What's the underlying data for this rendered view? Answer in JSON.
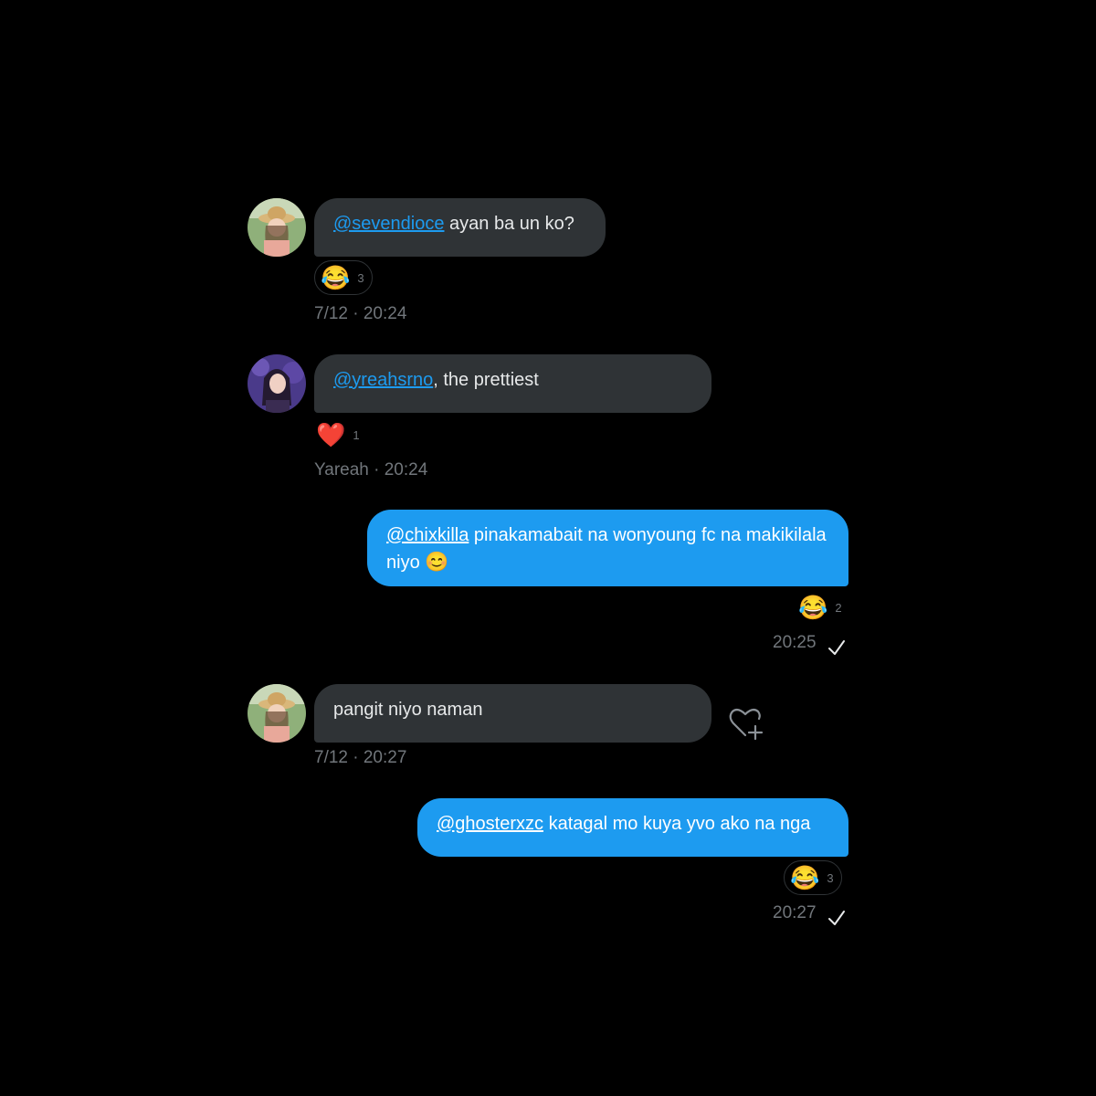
{
  "messages": [
    {
      "mention": "@sevendioce",
      "text": " ayan ba un ko?",
      "reaction": {
        "emoji": "😂",
        "count": "3"
      },
      "meta": "7/12 · 20:24"
    },
    {
      "mention": "@yreahsrno",
      "text": ", the prettiest",
      "reaction": {
        "emoji": "❤️",
        "count": "1"
      },
      "meta": "Yareah · 20:24"
    },
    {
      "mention": "@chixkilla",
      "text": " pinakamabait na wonyoung fc na makikilala niyo ",
      "text_emoji": "😊",
      "reaction": {
        "emoji": "😂",
        "count": "2"
      },
      "meta": "20:25"
    },
    {
      "text": "pangit niyo naman",
      "meta": "7/12 · 20:27"
    },
    {
      "mention": "@ghosterxzc",
      "text": " katagal mo kuya yvo ako na nga",
      "reaction": {
        "emoji": "😂",
        "count": "3"
      },
      "meta": "20:27"
    }
  ],
  "icons": {
    "avatar_1": "girl-in-straw-hat-avatar",
    "avatar_2": "girl-purple-background-avatar",
    "check": "sent-check-icon",
    "add_reaction": "heart-plus-icon"
  },
  "colors": {
    "background": "#000000",
    "incoming_bubble": "#2f3336",
    "outgoing_bubble": "#1d9bf0",
    "mention_link": "#1d9bf0",
    "meta_text": "#71767b"
  }
}
